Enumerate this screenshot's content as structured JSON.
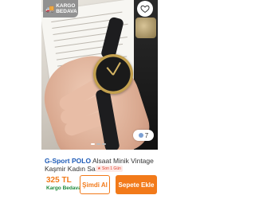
{
  "product": {
    "badge": {
      "line1": "KARGO",
      "line2": "BEDAVA",
      "icon": "truck-icon"
    },
    "favorite_icon": "heart-icon",
    "image_count": "7",
    "brand": "G-Sport POLO",
    "title": "Alsaat Minik Vintage Kaşmir Kadın Saati",
    "rating_chip": "★ Son 1 Gün",
    "price": "325 TL",
    "free_shipping": "Kargo Bedava",
    "buy_now_label": "Şimdi Al",
    "add_to_cart_label": "Sepete Ekle",
    "colors": {
      "accent": "#f27a1a",
      "brand": "#1e5bb7",
      "free_shipping": "#1e8a3a"
    }
  }
}
